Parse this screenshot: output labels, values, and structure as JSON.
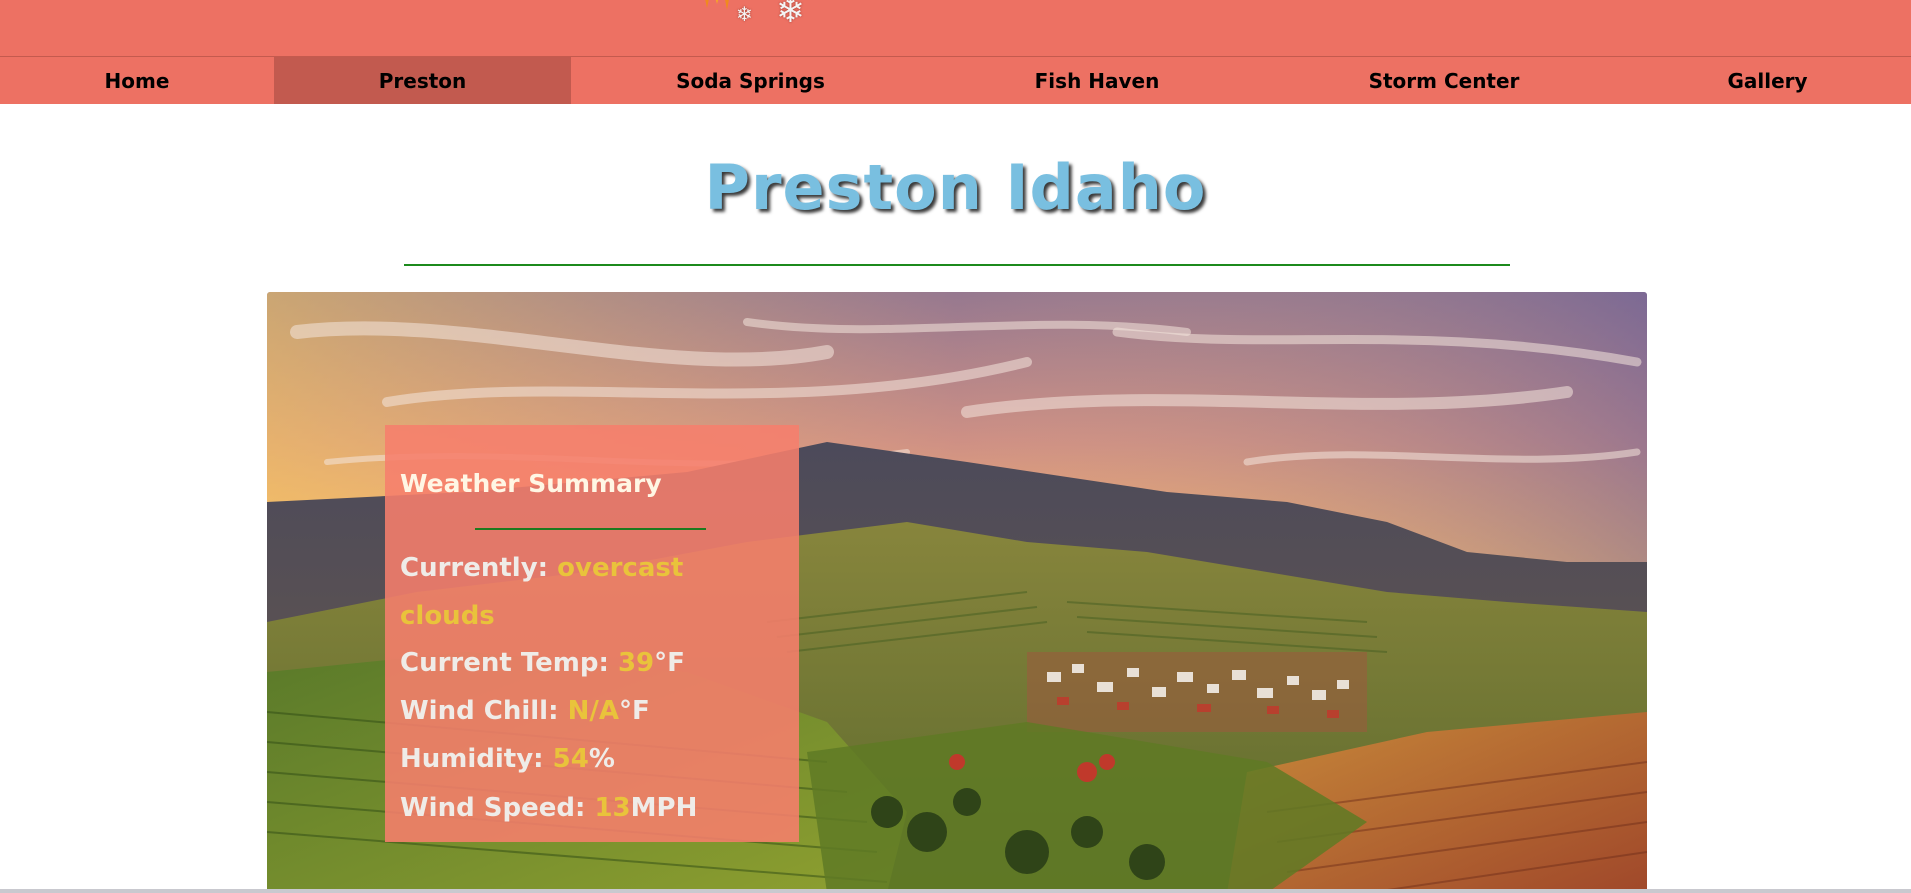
{
  "nav": {
    "items": [
      {
        "label": "Home"
      },
      {
        "label": "Preston",
        "active": true
      },
      {
        "label": "Soda Springs"
      },
      {
        "label": "Fish Haven"
      },
      {
        "label": "Storm Center"
      },
      {
        "label": "Gallery"
      }
    ]
  },
  "banner": {
    "logo_icons": [
      "sun-icon",
      "snowflake-icon",
      "snowflake-icon"
    ]
  },
  "page": {
    "title": "Preston Idaho"
  },
  "weather_summary": {
    "heading": "Weather Summary",
    "currently_label": "Currently:",
    "currently_value_line1": "overcast",
    "currently_value_line2": "clouds",
    "temp_label": "Current Temp:",
    "temp_value": "39",
    "temp_unit": "°F",
    "windchill_label": "Wind Chill:",
    "windchill_value": "N/A",
    "windchill_unit": "°F",
    "humidity_label": "Humidity:",
    "humidity_value": "54",
    "humidity_unit": "%",
    "windspeed_label": "Wind Speed:",
    "windspeed_value": "13",
    "windspeed_unit": "MPH"
  },
  "colors": {
    "banner": "#ed7163",
    "nav_active": "#c25a4f",
    "title": "#79bfe0",
    "rule": "#1c8a1c",
    "card_bg": "#f67e6c",
    "value_highlight": "#e9c33b"
  }
}
